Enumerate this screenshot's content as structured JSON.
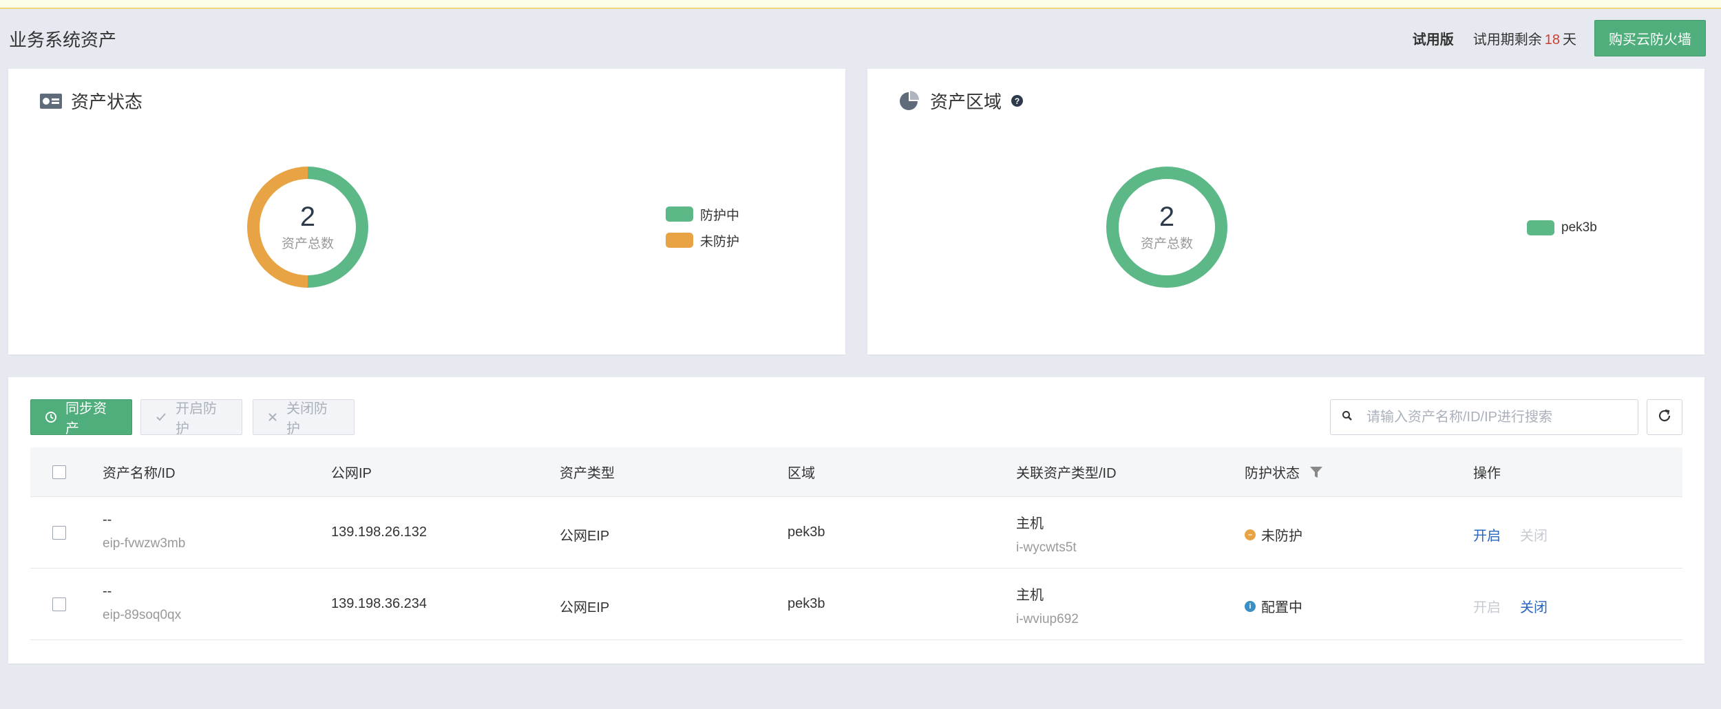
{
  "header": {
    "title": "业务系统资产",
    "trial_label": "试用版",
    "trial_remain_prefix": "试用期剩余",
    "trial_days": "18",
    "trial_remain_suffix": "天",
    "buy_button": "购买云防火墙"
  },
  "status_card": {
    "title": "资产状态",
    "total": "2",
    "total_label": "资产总数",
    "legend": [
      {
        "label": "防护中",
        "color": "#5db887"
      },
      {
        "label": "未防护",
        "color": "#e8a344"
      }
    ]
  },
  "region_card": {
    "title": "资产区域",
    "total": "2",
    "total_label": "资产总数",
    "legend": [
      {
        "label": "pek3b",
        "color": "#5db887"
      }
    ]
  },
  "chart_data": [
    {
      "type": "pie",
      "title": "资产状态",
      "categories": [
        "防护中",
        "未防护"
      ],
      "values": [
        1,
        1
      ],
      "colors": [
        "#5db887",
        "#e8a344"
      ],
      "legend_position": "right"
    },
    {
      "type": "pie",
      "title": "资产区域",
      "categories": [
        "pek3b"
      ],
      "values": [
        2
      ],
      "colors": [
        "#5db887"
      ],
      "legend_position": "right"
    }
  ],
  "toolbar": {
    "sync_label": "同步资产",
    "open_label": "开启防护",
    "close_label": "关闭防护",
    "search_placeholder": "请输入资产名称/ID/IP进行搜索"
  },
  "table": {
    "columns": [
      "资产名称/ID",
      "公网IP",
      "资产类型",
      "区域",
      "关联资产类型/ID",
      "防护状态",
      "操作"
    ],
    "rows": [
      {
        "name": "--",
        "id": "eip-fvwzw3mb",
        "ip": "139.198.26.132",
        "type": "公网EIP",
        "region": "pek3b",
        "rel_type": "主机",
        "rel_id": "i-wycwts5t",
        "status": "未防护",
        "status_color": "#e8a344",
        "action_open": "开启",
        "action_close": "关闭",
        "open_enabled": true,
        "close_enabled": false
      },
      {
        "name": "--",
        "id": "eip-89soq0qx",
        "ip": "139.198.36.234",
        "type": "公网EIP",
        "region": "pek3b",
        "rel_type": "主机",
        "rel_id": "i-wviup692",
        "status": "配置中",
        "status_color": "#3b8fc2",
        "action_open": "开启",
        "action_close": "关闭",
        "open_enabled": false,
        "close_enabled": true
      }
    ]
  }
}
